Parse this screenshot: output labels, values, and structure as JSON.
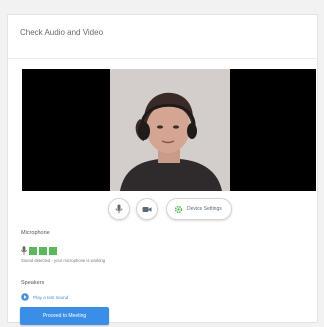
{
  "card": {
    "title": "Check Audio and Video"
  },
  "controls": {
    "mic_icon": "microphone-icon",
    "camera_icon": "camera-icon",
    "settings_icon": "gear-icon",
    "settings_label": "Device Settings"
  },
  "microphone": {
    "label": "Microphone",
    "level_bars_active": 3,
    "level_bars_total": 3,
    "hint": "Sound detected - your microphone is working"
  },
  "speakers": {
    "label": "Speakers",
    "play_icon": "play-icon",
    "test_link": "Play a test sound"
  },
  "footer": {
    "primary_label": "Proceed to Meeting"
  },
  "colors": {
    "accent": "#3a8ee6",
    "meter": "#5cb85c",
    "link": "#4a90d9"
  }
}
